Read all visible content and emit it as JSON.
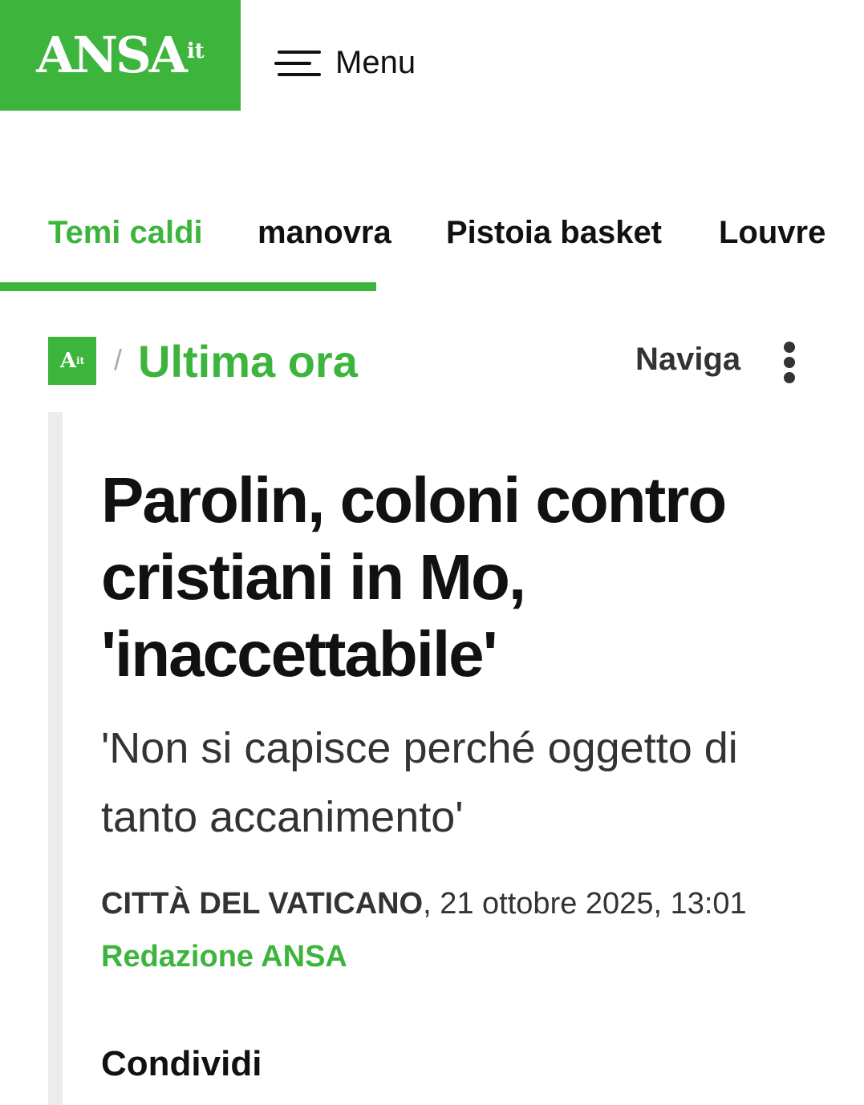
{
  "header": {
    "logo_text": "ANSA",
    "logo_suffix": "it",
    "menu_label": "Menu"
  },
  "tabs": [
    {
      "label": "Temi caldi",
      "active": true
    },
    {
      "label": "manovra"
    },
    {
      "label": "Pistoia basket"
    },
    {
      "label": "Louvre"
    }
  ],
  "section": {
    "logo_text": "A",
    "logo_suffix": "it",
    "separator": "/",
    "title": "Ultima ora",
    "naviga_label": "Naviga"
  },
  "article": {
    "headline": "Parolin, coloni contro cristiani in Mo, 'inaccettabile'",
    "subheadline": "'Non si capisce perché oggetto di tanto accanimento'",
    "location": "CITTÀ DEL VATICANO",
    "datetime": ", 21 ottobre 2025, 13:01",
    "author": "Redazione ANSA",
    "share_label": "Condividi"
  },
  "colors": {
    "brand_green": "#3db53d",
    "text": "#111111",
    "secondary_text": "#333333"
  }
}
